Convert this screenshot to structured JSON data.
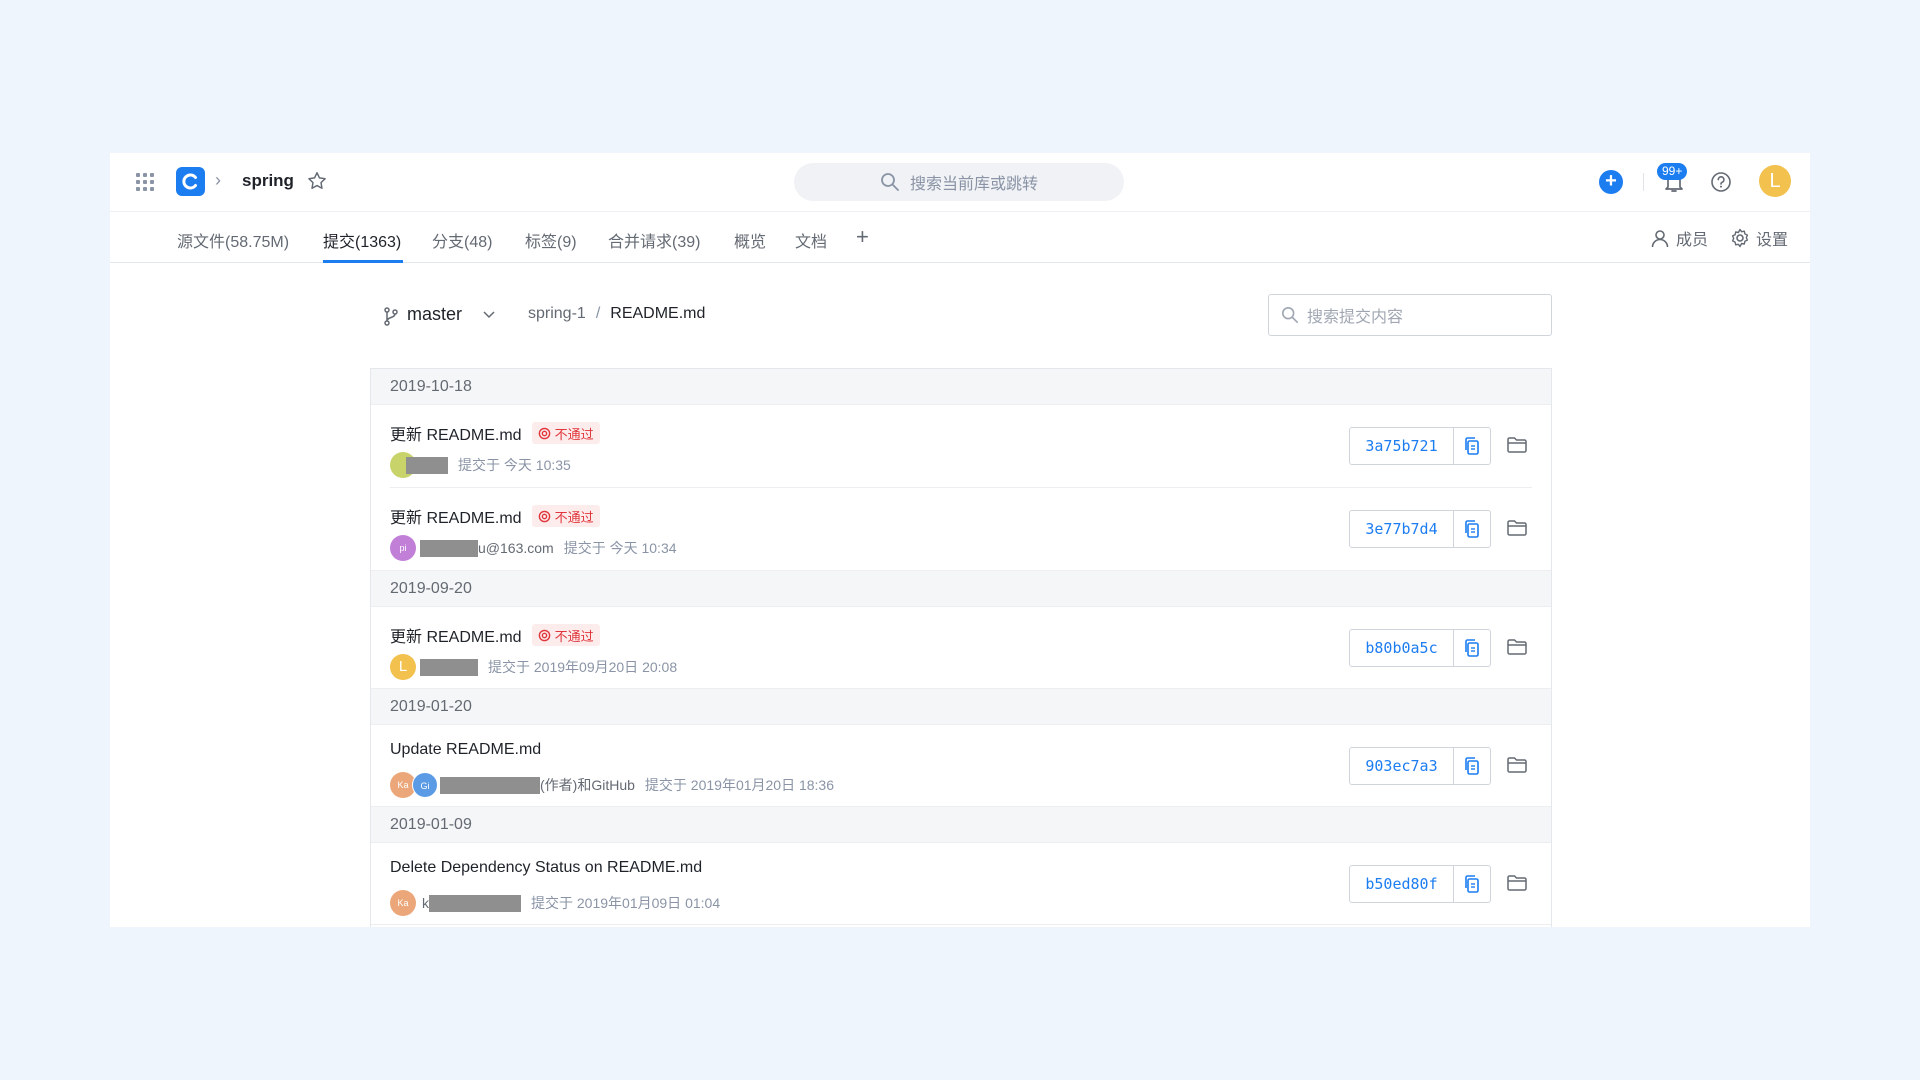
{
  "header": {
    "repo_name": "spring",
    "global_search_placeholder": "搜索当前库或跳转",
    "notification_badge": "99+",
    "user_initial": "L"
  },
  "tabs": [
    {
      "label": "源文件(58.75M)"
    },
    {
      "label": "提交(1363)"
    },
    {
      "label": "分支(48)"
    },
    {
      "label": "标签(9)"
    },
    {
      "label": "合并请求(39)"
    },
    {
      "label": "概览"
    },
    {
      "label": "文档"
    }
  ],
  "tab_add": "+",
  "right_links": {
    "members": "成员",
    "settings": "设置"
  },
  "filter": {
    "branch": "master",
    "path_root": "spring-1",
    "path_sep": "/",
    "path_file": "README.md",
    "search_placeholder": "搜索提交内容"
  },
  "groups": [
    {
      "date": "2019-10-18",
      "commits": [
        {
          "title": "更新 README.md",
          "status": "不通过",
          "author_suffix": "",
          "time": "提交于 今天 10:35",
          "sha": "3a75b721"
        },
        {
          "title": "更新 README.md",
          "status": "不通过",
          "avatar_text": "pi",
          "author_suffix": "u@163.com",
          "time": "提交于 今天 10:34",
          "sha": "3e77b7d4"
        }
      ]
    },
    {
      "date": "2019-09-20",
      "commits": [
        {
          "title": "更新 README.md",
          "status": "不通过",
          "avatar_text": "L",
          "time": "提交于 2019年09月20日 20:08",
          "sha": "b80b0a5c"
        }
      ]
    },
    {
      "date": "2019-01-20",
      "commits": [
        {
          "title": "Update README.md",
          "avatar_text": "Ka",
          "avatar2_text": "Gi",
          "author_suffix": "(作者)和GitHub",
          "time": "提交于 2019年01月20日 18:36",
          "sha": "903ec7a3"
        }
      ]
    },
    {
      "date": "2019-01-09",
      "commits": [
        {
          "title": "Delete Dependency Status on README.md",
          "avatar_text": "Ka",
          "author_prefix": "k",
          "time": "提交于 2019年01月09日 01:04",
          "sha": "b50ed80f"
        }
      ]
    }
  ],
  "colors": {
    "accent": "#1c7df1",
    "fail_text": "#e0353a",
    "fail_bg": "#fdecec"
  }
}
